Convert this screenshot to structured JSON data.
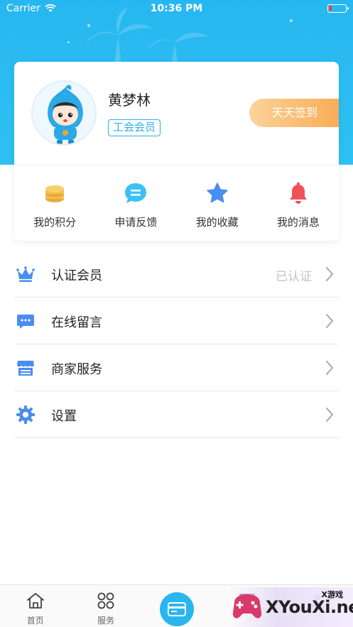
{
  "status_bar": {
    "carrier": "Carrier",
    "time": "10:36 PM"
  },
  "profile": {
    "name": "黄梦林",
    "member_badge": "工会会员",
    "signin_label": "天天签到"
  },
  "quick_actions": [
    {
      "label": "我的积分",
      "icon": "coins-icon",
      "color": "#f3c04a"
    },
    {
      "label": "申请反馈",
      "icon": "chat-bubble-icon",
      "color": "#3cc2f2"
    },
    {
      "label": "我的收藏",
      "icon": "star-icon",
      "color": "#4a8df0"
    },
    {
      "label": "我的消息",
      "icon": "bell-icon",
      "color": "#f0505a"
    }
  ],
  "menu": [
    {
      "label": "认证会员",
      "value": "已认证",
      "icon": "crown-icon"
    },
    {
      "label": "在线留言",
      "value": "",
      "icon": "message-icon"
    },
    {
      "label": "商家服务",
      "value": "",
      "icon": "store-icon"
    },
    {
      "label": "设置",
      "value": "",
      "icon": "gear-icon"
    }
  ],
  "tabbar": [
    {
      "label": "首页",
      "icon": "home-icon"
    },
    {
      "label": "服务",
      "icon": "grid-icon"
    },
    {
      "label": "",
      "icon": "card-icon"
    },
    {
      "label": "",
      "icon": "message-icon"
    },
    {
      "label": "",
      "icon": "person-icon"
    }
  ],
  "watermark": {
    "text": "XYouXi.net",
    "sub": "X游戏"
  },
  "colors": {
    "header": "#27b7f0",
    "accent": "#2bb0ec",
    "signin": "#f9a84f"
  }
}
